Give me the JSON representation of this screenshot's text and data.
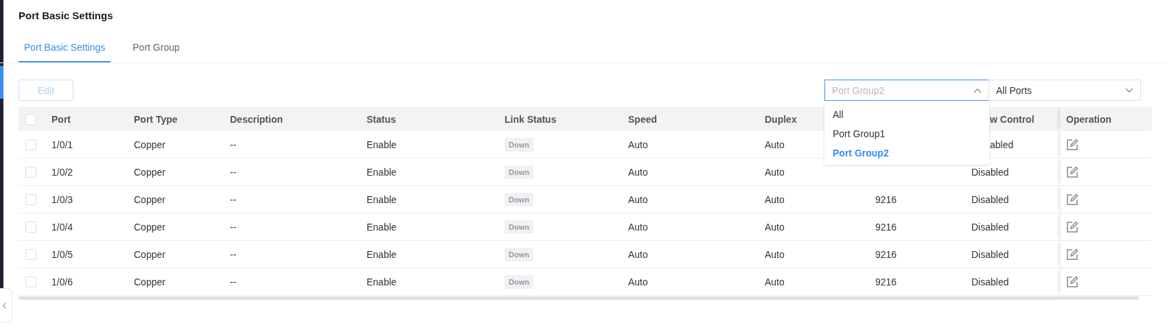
{
  "page": {
    "title": "Port Basic Settings"
  },
  "tabs": [
    {
      "label": "Port Basic Settings",
      "selected": true
    },
    {
      "label": "Port Group",
      "selected": false
    }
  ],
  "toolbar": {
    "edit_button": {
      "label": "Edit",
      "disabled": true
    },
    "group_select": {
      "value": "Port Group2",
      "expanded": true,
      "options": [
        {
          "label": "All",
          "selected": false
        },
        {
          "label": "Port Group1",
          "selected": false
        },
        {
          "label": "Port Group2",
          "selected": true
        }
      ]
    },
    "port_select": {
      "value": "All Ports",
      "expanded": false
    }
  },
  "table": {
    "select_all_checked": false,
    "headers": {
      "port": "Port",
      "port_type": "Port Type",
      "description": "Description",
      "status": "Status",
      "link_status": "Link Status",
      "speed": "Speed",
      "duplex": "Duplex",
      "flow_control": "w Control",
      "operation": "Operation"
    },
    "rows": [
      {
        "checked": false,
        "port": "1/0/1",
        "port_type": "Copper",
        "description": "--",
        "status": "Enable",
        "link_status": "Down",
        "speed": "Auto",
        "duplex": "Auto",
        "flow_control": "abled"
      },
      {
        "checked": false,
        "port": "1/0/2",
        "port_type": "Copper",
        "description": "--",
        "status": "Enable",
        "link_status": "Down",
        "speed": "Auto",
        "duplex": "Auto",
        "flow_control": "Disabled"
      },
      {
        "checked": false,
        "port": "1/0/3",
        "port_type": "Copper",
        "description": "--",
        "status": "Enable",
        "link_status": "Down",
        "speed": "Auto",
        "duplex": "Auto",
        "column_8": "9216",
        "flow_control": "Disabled"
      },
      {
        "checked": false,
        "port": "1/0/4",
        "port_type": "Copper",
        "description": "--",
        "status": "Enable",
        "link_status": "Down",
        "speed": "Auto",
        "duplex": "Auto",
        "column_8": "9216",
        "flow_control": "Disabled"
      },
      {
        "checked": false,
        "port": "1/0/5",
        "port_type": "Copper",
        "description": "--",
        "status": "Enable",
        "link_status": "Down",
        "speed": "Auto",
        "duplex": "Auto",
        "column_8": "9216",
        "flow_control": "Disabled"
      },
      {
        "checked": false,
        "port": "1/0/6",
        "port_type": "Copper",
        "description": "--",
        "status": "Enable",
        "link_status": "Down",
        "speed": "Auto",
        "duplex": "Auto",
        "column_8": "9216",
        "flow_control": "Disabled"
      }
    ]
  }
}
